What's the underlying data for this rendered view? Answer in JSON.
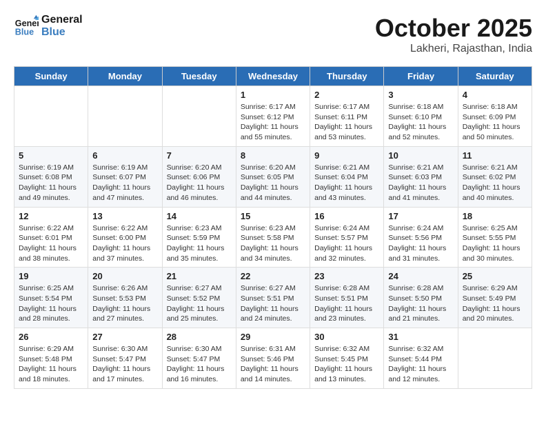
{
  "header": {
    "logo_line1": "General",
    "logo_line2": "Blue",
    "month": "October 2025",
    "location": "Lakheri, Rajasthan, India"
  },
  "weekdays": [
    "Sunday",
    "Monday",
    "Tuesday",
    "Wednesday",
    "Thursday",
    "Friday",
    "Saturday"
  ],
  "weeks": [
    [
      {
        "day": "",
        "info": ""
      },
      {
        "day": "",
        "info": ""
      },
      {
        "day": "",
        "info": ""
      },
      {
        "day": "1",
        "info": "Sunrise: 6:17 AM\nSunset: 6:12 PM\nDaylight: 11 hours\nand 55 minutes."
      },
      {
        "day": "2",
        "info": "Sunrise: 6:17 AM\nSunset: 6:11 PM\nDaylight: 11 hours\nand 53 minutes."
      },
      {
        "day": "3",
        "info": "Sunrise: 6:18 AM\nSunset: 6:10 PM\nDaylight: 11 hours\nand 52 minutes."
      },
      {
        "day": "4",
        "info": "Sunrise: 6:18 AM\nSunset: 6:09 PM\nDaylight: 11 hours\nand 50 minutes."
      }
    ],
    [
      {
        "day": "5",
        "info": "Sunrise: 6:19 AM\nSunset: 6:08 PM\nDaylight: 11 hours\nand 49 minutes."
      },
      {
        "day": "6",
        "info": "Sunrise: 6:19 AM\nSunset: 6:07 PM\nDaylight: 11 hours\nand 47 minutes."
      },
      {
        "day": "7",
        "info": "Sunrise: 6:20 AM\nSunset: 6:06 PM\nDaylight: 11 hours\nand 46 minutes."
      },
      {
        "day": "8",
        "info": "Sunrise: 6:20 AM\nSunset: 6:05 PM\nDaylight: 11 hours\nand 44 minutes."
      },
      {
        "day": "9",
        "info": "Sunrise: 6:21 AM\nSunset: 6:04 PM\nDaylight: 11 hours\nand 43 minutes."
      },
      {
        "day": "10",
        "info": "Sunrise: 6:21 AM\nSunset: 6:03 PM\nDaylight: 11 hours\nand 41 minutes."
      },
      {
        "day": "11",
        "info": "Sunrise: 6:21 AM\nSunset: 6:02 PM\nDaylight: 11 hours\nand 40 minutes."
      }
    ],
    [
      {
        "day": "12",
        "info": "Sunrise: 6:22 AM\nSunset: 6:01 PM\nDaylight: 11 hours\nand 38 minutes."
      },
      {
        "day": "13",
        "info": "Sunrise: 6:22 AM\nSunset: 6:00 PM\nDaylight: 11 hours\nand 37 minutes."
      },
      {
        "day": "14",
        "info": "Sunrise: 6:23 AM\nSunset: 5:59 PM\nDaylight: 11 hours\nand 35 minutes."
      },
      {
        "day": "15",
        "info": "Sunrise: 6:23 AM\nSunset: 5:58 PM\nDaylight: 11 hours\nand 34 minutes."
      },
      {
        "day": "16",
        "info": "Sunrise: 6:24 AM\nSunset: 5:57 PM\nDaylight: 11 hours\nand 32 minutes."
      },
      {
        "day": "17",
        "info": "Sunrise: 6:24 AM\nSunset: 5:56 PM\nDaylight: 11 hours\nand 31 minutes."
      },
      {
        "day": "18",
        "info": "Sunrise: 6:25 AM\nSunset: 5:55 PM\nDaylight: 11 hours\nand 30 minutes."
      }
    ],
    [
      {
        "day": "19",
        "info": "Sunrise: 6:25 AM\nSunset: 5:54 PM\nDaylight: 11 hours\nand 28 minutes."
      },
      {
        "day": "20",
        "info": "Sunrise: 6:26 AM\nSunset: 5:53 PM\nDaylight: 11 hours\nand 27 minutes."
      },
      {
        "day": "21",
        "info": "Sunrise: 6:27 AM\nSunset: 5:52 PM\nDaylight: 11 hours\nand 25 minutes."
      },
      {
        "day": "22",
        "info": "Sunrise: 6:27 AM\nSunset: 5:51 PM\nDaylight: 11 hours\nand 24 minutes."
      },
      {
        "day": "23",
        "info": "Sunrise: 6:28 AM\nSunset: 5:51 PM\nDaylight: 11 hours\nand 23 minutes."
      },
      {
        "day": "24",
        "info": "Sunrise: 6:28 AM\nSunset: 5:50 PM\nDaylight: 11 hours\nand 21 minutes."
      },
      {
        "day": "25",
        "info": "Sunrise: 6:29 AM\nSunset: 5:49 PM\nDaylight: 11 hours\nand 20 minutes."
      }
    ],
    [
      {
        "day": "26",
        "info": "Sunrise: 6:29 AM\nSunset: 5:48 PM\nDaylight: 11 hours\nand 18 minutes."
      },
      {
        "day": "27",
        "info": "Sunrise: 6:30 AM\nSunset: 5:47 PM\nDaylight: 11 hours\nand 17 minutes."
      },
      {
        "day": "28",
        "info": "Sunrise: 6:30 AM\nSunset: 5:47 PM\nDaylight: 11 hours\nand 16 minutes."
      },
      {
        "day": "29",
        "info": "Sunrise: 6:31 AM\nSunset: 5:46 PM\nDaylight: 11 hours\nand 14 minutes."
      },
      {
        "day": "30",
        "info": "Sunrise: 6:32 AM\nSunset: 5:45 PM\nDaylight: 11 hours\nand 13 minutes."
      },
      {
        "day": "31",
        "info": "Sunrise: 6:32 AM\nSunset: 5:44 PM\nDaylight: 11 hours\nand 12 minutes."
      },
      {
        "day": "",
        "info": ""
      }
    ]
  ]
}
